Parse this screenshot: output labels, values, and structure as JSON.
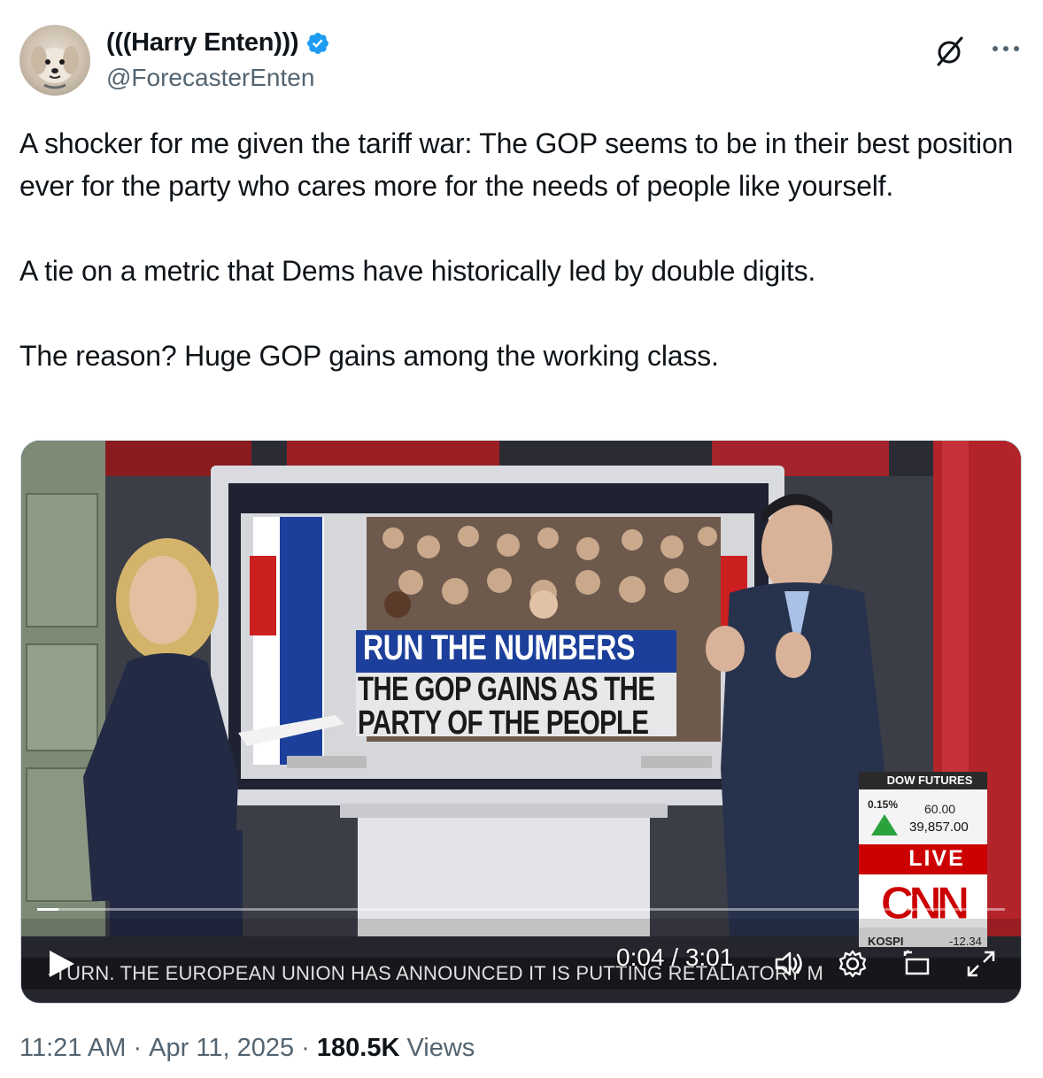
{
  "author": {
    "display_name": "(((Harry Enten)))",
    "handle": "@ForecasterEnten",
    "verified": true,
    "avatar_icon": "dog-avatar"
  },
  "tweet": {
    "text": "A shocker for me given the tariff war: The GOP seems to be in their best position ever for the party who cares more for the needs of people like yourself.\n\nA tie on a metric that Dems have historically led by double digits.\n\nThe reason? Huge GOP gains among the working class."
  },
  "video": {
    "graphic_title": "RUN THE NUMBERS",
    "graphic_subtitle": "THE GOP GAINS AS THE\nPARTY OF THE PEOPLE",
    "dow": {
      "label": "DOW FUTURES",
      "pct": "0.15%",
      "change": "60.00",
      "value": "39,857.00"
    },
    "live_label": "LIVE",
    "network_logo": "CNN",
    "kospi": {
      "label": "KOSPI",
      "value": "-12.34"
    },
    "ticker": "-TURN. THE EUROPEAN UNION HAS ANNOUNCED IT IS PUTTING RETALIATORY M",
    "timecode": "0:04 / 3:01",
    "progress": 0.022
  },
  "footer": {
    "time": "11:21 AM",
    "separator": " · ",
    "date": "Apr 11, 2025",
    "views_count": "180.5K",
    "views_label": " Views"
  },
  "colors": {
    "verified_blue": "#1d9bf0",
    "cnn_red": "#cc0000",
    "graphic_blue": "#1b3f9a"
  }
}
